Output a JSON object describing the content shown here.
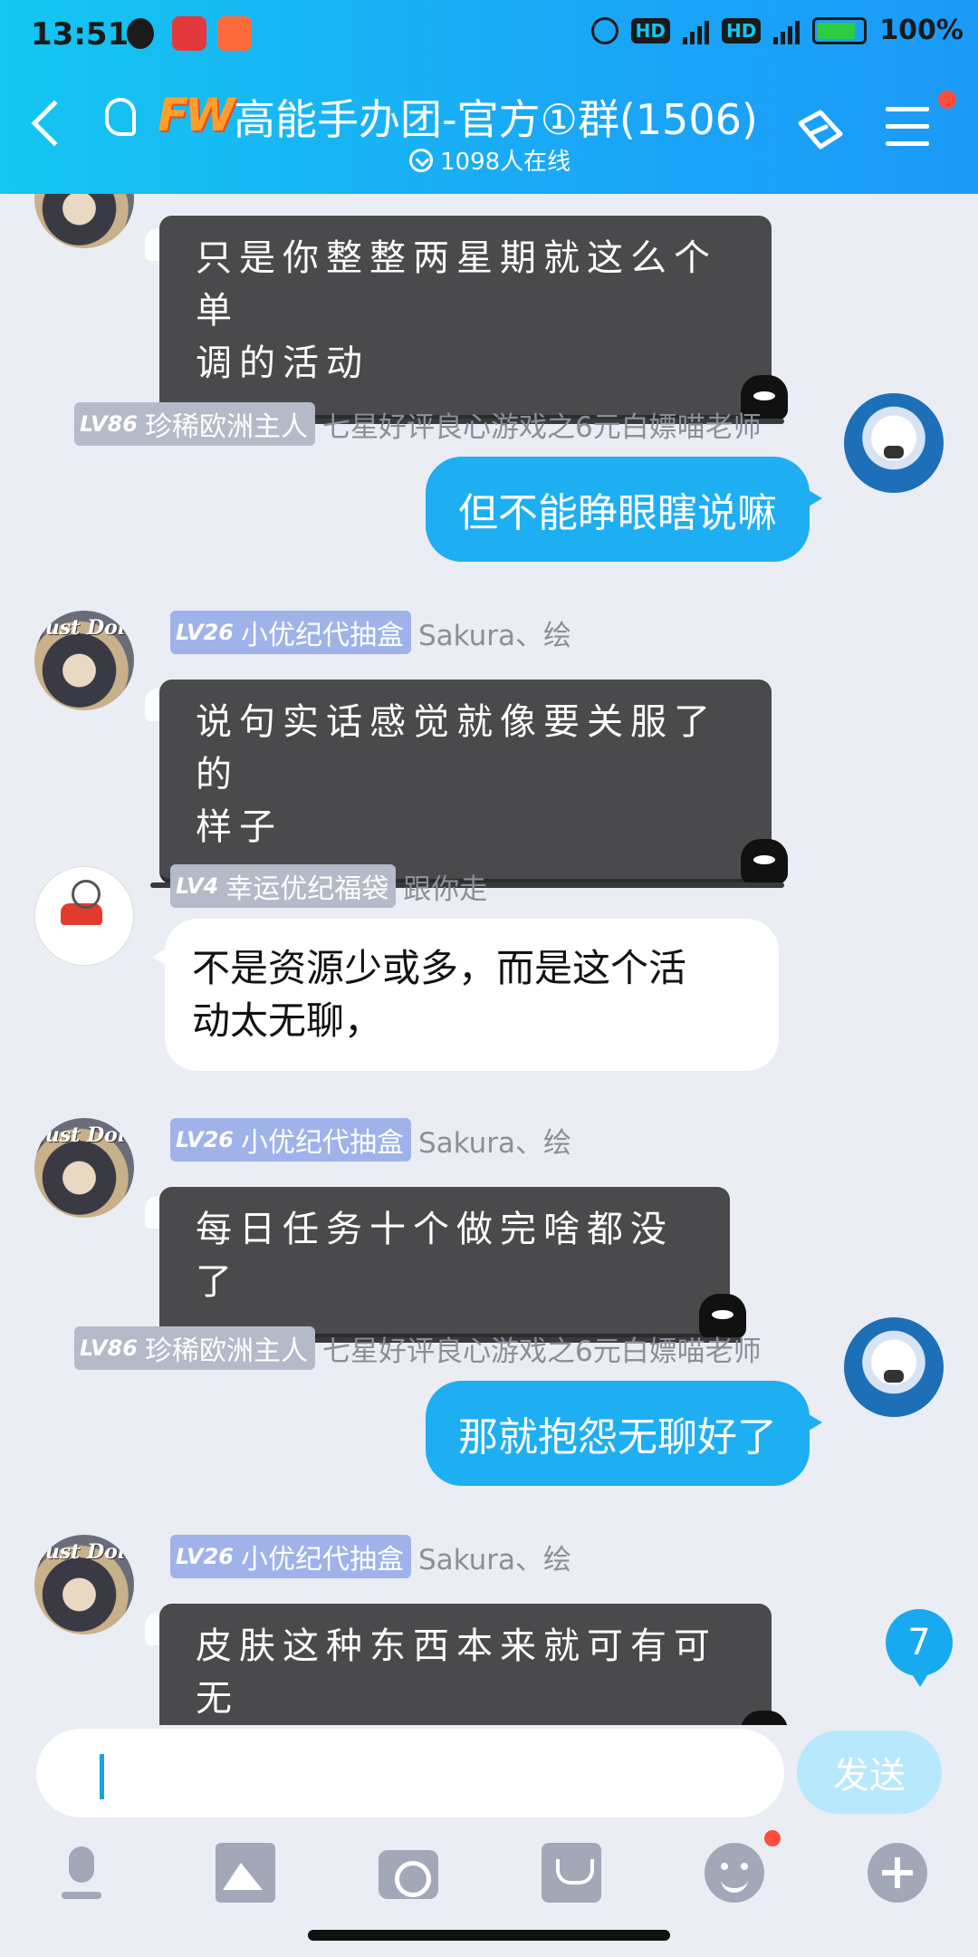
{
  "status_bar": {
    "time": "13:51",
    "battery": "100%",
    "hd": "HD",
    "network": "4G"
  },
  "header": {
    "logo": "FW",
    "title": "高能手办团-官方①群(1506)",
    "online": "1098人在线"
  },
  "messages": [
    {
      "lines": [
        "只是你整整两星期就这么个单",
        "调的活动"
      ]
    },
    {
      "level": "LV86",
      "title": "珍稀欧洲主人",
      "name": "七星好评良心游戏之6元白嫖喵老师",
      "text": "但不能睁眼瞎说嘛"
    },
    {
      "level": "LV26",
      "title": "小优纪代抽盒",
      "name": "Sakura、绘",
      "lines": [
        "说句实话感觉就像要关服了的",
        "样子"
      ]
    },
    {
      "level": "LV4",
      "title": "幸运优纪福袋",
      "name": "跟你走",
      "lines": [
        "不是资源少或多，而是这个活",
        "动太无聊，"
      ]
    },
    {
      "level": "LV26",
      "title": "小优纪代抽盒",
      "name": "Sakura、绘",
      "text": "每日任务十个做完啥都没了"
    },
    {
      "level": "LV86",
      "title": "珍稀欧洲主人",
      "name": "七星好评良心游戏之6元白嫖喵老师",
      "text": "那就抱怨无聊好了"
    },
    {
      "level": "LV26",
      "title": "小优纪代抽盒",
      "name": "Sakura、绘",
      "text": "皮肤这种东西本来就可有可无"
    }
  ],
  "unread_count": "7",
  "input": {
    "send_label": "发送"
  },
  "colors": {
    "header": "#1aa7f7",
    "bubble_self": "#1eaef2",
    "bubble_dark": "#4a4a4c"
  }
}
